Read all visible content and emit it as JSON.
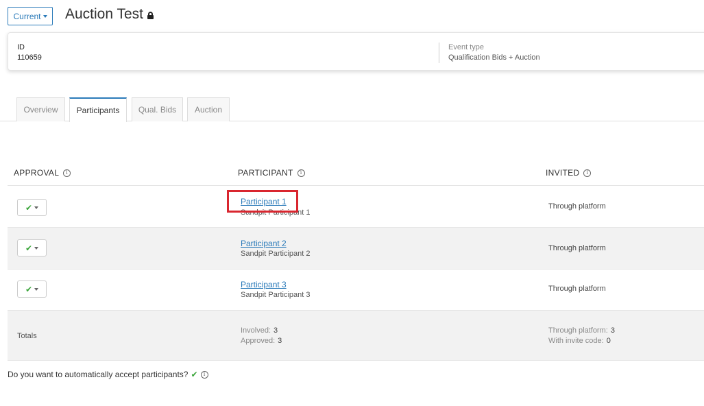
{
  "header": {
    "version_button": "Current",
    "title": "Auction Test"
  },
  "info_card": {
    "id_label": "ID",
    "id_value": "110659",
    "event_type_label": "Event type",
    "event_type_value": "Qualification Bids + Auction"
  },
  "tabs": [
    {
      "label": "Overview",
      "active": false
    },
    {
      "label": "Participants",
      "active": true
    },
    {
      "label": "Qual. Bids",
      "active": false
    },
    {
      "label": "Auction",
      "active": false
    }
  ],
  "table": {
    "headers": {
      "approval": "APPROVAL",
      "participant": "PARTICIPANT",
      "invited": "INVITED"
    },
    "rows": [
      {
        "name": "Participant 1",
        "company": "Sandpit Participant 1",
        "invited": "Through platform",
        "approved": true
      },
      {
        "name": "Participant 2",
        "company": "Sandpit Participant 2",
        "invited": "Through platform",
        "approved": true
      },
      {
        "name": "Participant 3",
        "company": "Sandpit Participant 3",
        "invited": "Through platform",
        "approved": true
      }
    ],
    "totals": {
      "label": "Totals",
      "involved_label": "Involved:",
      "involved_value": "3",
      "approved_label": "Approved:",
      "approved_value": "3",
      "through_platform_label": "Through platform:",
      "through_platform_value": "3",
      "invite_code_label": "With invite code:",
      "invite_code_value": "0"
    }
  },
  "footer": {
    "auto_accept_question": "Do you want to automatically accept participants?"
  },
  "colors": {
    "accent": "#2a7ab9",
    "check": "#3aa53a",
    "highlight": "#d9262f"
  }
}
